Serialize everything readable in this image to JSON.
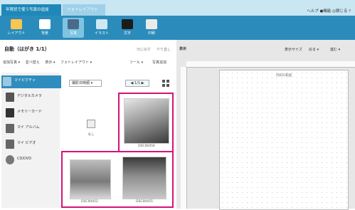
{
  "topbar": {
    "tabs": [
      {
        "label": "年賀状で使う写真の追加"
      },
      {
        "label": "フォトレイアウト"
      }
    ],
    "right_links": "ヘルプ  ●機能  ◎閉じる  ?"
  },
  "ribbon": {
    "buttons": [
      {
        "label": "レイアウト",
        "icon": "layout-icon"
      },
      {
        "label": "背景",
        "icon": "background-icon"
      },
      {
        "label": "写真",
        "icon": "photo-icon"
      },
      {
        "label": "イラスト",
        "icon": "illustration-icon"
      },
      {
        "label": "文字",
        "icon": "text-icon"
      },
      {
        "label": "印刷",
        "icon": "print-icon"
      }
    ]
  },
  "left": {
    "title": "自動（はがき 1/1）",
    "header_right": [
      "元に戻す",
      "やり直し"
    ],
    "menu": [
      "追加写真 ▾",
      "並べ替え",
      "表示 ▾",
      "フォトレイアウト ▾"
    ],
    "menu_right": [
      "ツール ▾",
      "写真追加"
    ],
    "sidebar": [
      {
        "label": "マイピクチャ"
      },
      {
        "label": "デジタルカメラ"
      },
      {
        "label": "メモリーカード"
      },
      {
        "label": "マイ アルバム"
      },
      {
        "label": "マイ ビデオ"
      },
      {
        "label": "CD/DVD"
      }
    ],
    "sort_select": "撮影日時順 ▾",
    "nav_select": "◀ 1/1 ▶",
    "thumbs": [
      {
        "caption": "なし",
        "kind": "placeholder"
      },
      {
        "caption": "DSC00456",
        "kind": "photo"
      },
      {
        "caption": "DSC00452",
        "kind": "photo"
      },
      {
        "caption": "DSC00455",
        "kind": "photo"
      }
    ]
  },
  "right": {
    "label": "表示",
    "controls": [
      "表示サイズ",
      "戻る ▾",
      "進む ▾"
    ],
    "canvas_title": "印刷の範囲"
  },
  "colors": {
    "accent": "#2b8cbb",
    "highlight": "#d4137a"
  }
}
